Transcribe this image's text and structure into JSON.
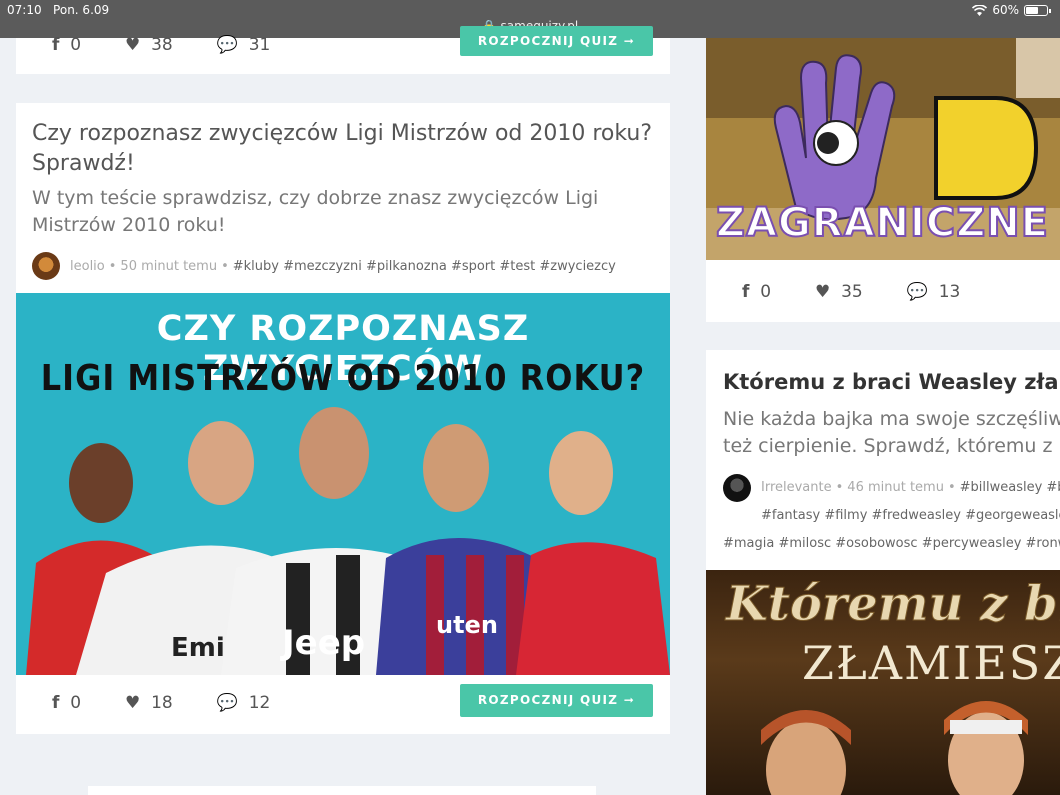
{
  "status_bar": {
    "time": "07:10",
    "date": "Pon. 6.09",
    "url": "samequizy.pl",
    "battery": "60%"
  },
  "top_card": {
    "fb_count": "0",
    "likes": "38",
    "comments": "31",
    "button": "ROZPOCZNIJ QUIZ ➞"
  },
  "main_card": {
    "title": "Czy rozpoznasz zwycięzców Ligi Mistrzów od 2010 roku? Sprawdź!",
    "description": "W tym teście sprawdzisz, czy dobrze znasz zwycięzców Ligi Mistrzów 2010 roku!",
    "author": "leolio",
    "time": "50 minut temu",
    "tags": "#kluby #mezczyzni #pilkanozna #sport #test #zwyciezcy",
    "image_line1": "CZY ROZPOZNASZ ZWYCIĘZCÓW",
    "image_line2": "LIGI MISTRZÓW OD 2010 ROKU?",
    "shirt_text1": "Emi",
    "shirt_text2": "Jeep",
    "shirt_text3": "uten",
    "fb_count": "0",
    "likes": "18",
    "comments": "12",
    "button": "ROZPOCZNIJ QUIZ ➞"
  },
  "right_top_card": {
    "image_text1": "Do",
    "image_text2": "ZAGRANICZNE I",
    "fb_count": "0",
    "likes": "35",
    "comments": "13"
  },
  "right_card": {
    "title": "Któremu z braci Weasley złami",
    "description_line1": "Nie każda bajka ma swoje szczęśliwe",
    "description_line2": "też cierpienie. Sprawdź, któremu z br",
    "author": "Irrelevante",
    "time": "46 minut temu",
    "tags_line1": "#billweasley #br",
    "tags_line2": "#fantasy #filmy #fredweasley #georgeweasley",
    "tags_line3": "#magia #milosc #osobowosc #percyweasley #ronw",
    "image_line1": "Któremu z bra",
    "image_line2": "ZŁAMIESZ"
  },
  "colors": {
    "accent": "#4ac6a8",
    "statusbar": "#5b5b5b",
    "background": "#eef1f5"
  },
  "icons": [
    "facebook-icon",
    "heart-icon",
    "comment-icon",
    "lock-icon",
    "wifi-icon",
    "battery-icon"
  ]
}
